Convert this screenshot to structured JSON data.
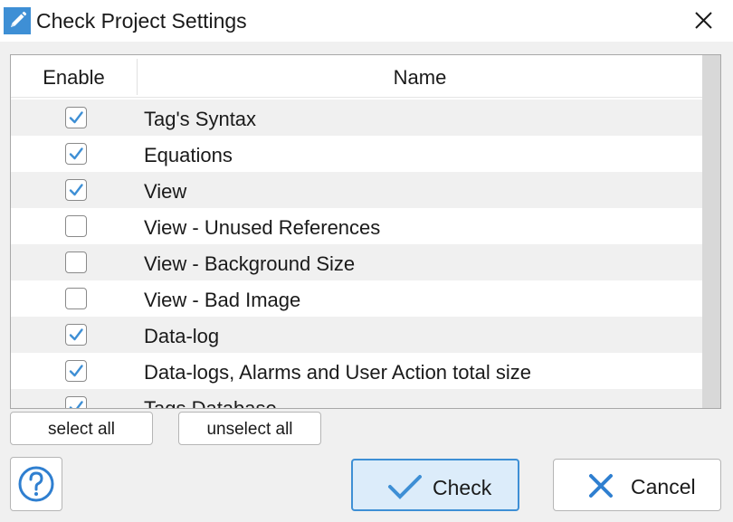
{
  "window": {
    "title": "Check Project Settings",
    "app_icon": "pencil-icon",
    "close_icon": "close-icon"
  },
  "grid": {
    "columns": [
      "Enable",
      "Name"
    ],
    "rows": [
      {
        "name": "Tag's Syntax",
        "checked": true
      },
      {
        "name": "Equations",
        "checked": true
      },
      {
        "name": "View",
        "checked": true
      },
      {
        "name": "View - Unused References",
        "checked": false
      },
      {
        "name": "View - Background Size",
        "checked": false
      },
      {
        "name": "View - Bad Image",
        "checked": false
      },
      {
        "name": "Data-log",
        "checked": true
      },
      {
        "name": "Data-logs, Alarms and User Action total size",
        "checked": true
      },
      {
        "name": "Tags Database",
        "checked": true
      }
    ]
  },
  "buttons": {
    "select_all": "select all",
    "unselect_all": "unselect all",
    "check": "Check",
    "cancel": "Cancel",
    "help_icon": "question-icon"
  },
  "colors": {
    "accent": "#3e8fd5",
    "check_mark": "#3e8fd5",
    "cancel_x": "#2f7fd0",
    "check_button_bg": "#dcecfa"
  }
}
